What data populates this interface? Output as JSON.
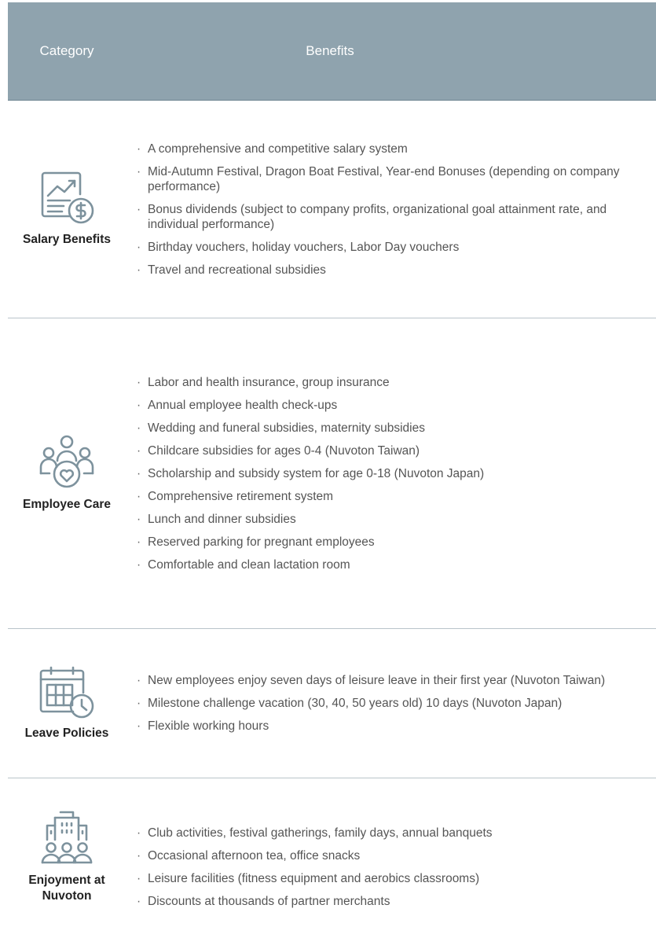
{
  "header": {
    "category_label": "Category",
    "benefits_label": "Benefits"
  },
  "rows": [
    {
      "category": "Salary Benefits",
      "icon": "salary-chart-dollar-icon",
      "items": [
        "A comprehensive and competitive salary system",
        "Mid-Autumn Festival, Dragon Boat Festival, Year-end Bonuses (depending on company performance)",
        "Bonus dividends (subject to company profits, organizational goal attainment rate, and individual performance)",
        "Birthday vouchers, holiday vouchers, Labor Day vouchers",
        "Travel and recreational subsidies"
      ]
    },
    {
      "category": "Employee Care",
      "icon": "people-heart-icon",
      "items": [
        "Labor and health insurance, group insurance",
        "Annual employee health check-ups",
        "Wedding and funeral subsidies, maternity subsidies",
        "Childcare subsidies for ages 0-4 (Nuvoton Taiwan)",
        "Scholarship and subsidy system for age 0-18 (Nuvoton Japan)",
        "Comprehensive retirement system",
        "Lunch and dinner subsidies",
        "Reserved parking for pregnant employees",
        "Comfortable and clean lactation room"
      ]
    },
    {
      "category": "Leave Policies",
      "icon": "calendar-clock-icon",
      "items": [
        "New employees enjoy seven days of leisure leave in their first year (Nuvoton Taiwan)",
        "Milestone challenge vacation (30, 40, 50 years old) 10 days (Nuvoton Japan)",
        "Flexible working hours"
      ]
    },
    {
      "category": "Enjoyment at Nuvoton",
      "icon": "building-people-icon",
      "items": [
        "Club activities, festival gatherings, family days, annual banquets",
        "Occasional afternoon tea, office snacks",
        "Leisure facilities (fitness equipment and aerobics classrooms)",
        "Discounts at thousands of partner merchants"
      ]
    }
  ],
  "colors": {
    "header_bg": "#8fa3ae",
    "icon_stroke": "#7d929d",
    "divider": "#b9c4ca"
  }
}
